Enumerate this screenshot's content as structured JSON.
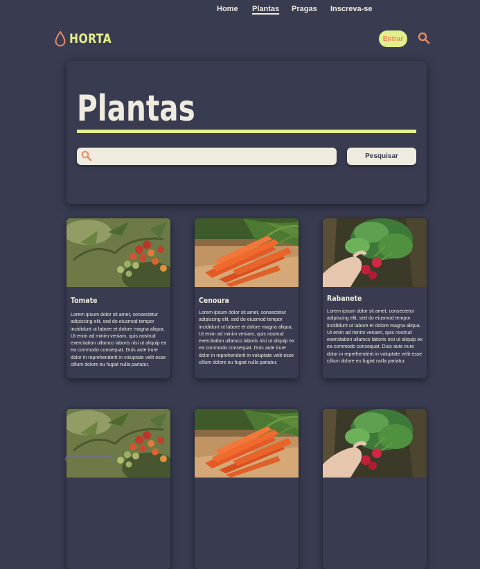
{
  "brand": {
    "name": "HORTA",
    "accent": "#e3f08a",
    "orange": "#e88a5e",
    "background": "#393c51",
    "cream": "#f0ebdf"
  },
  "nav": {
    "links": [
      "Home",
      "Plantas",
      "Pragas",
      "Inscreva-se"
    ],
    "active": "Plantas",
    "login_label": "Entrar"
  },
  "hero": {
    "title": "Plantas",
    "search_placeholder": "",
    "search_button": "Pesquisar"
  },
  "cards": [
    {
      "title": "Tomate",
      "image": "tomato-plant",
      "description": "Lorem ipsum dolor sit amet, consectetur adipiscing elit, sed do eiusmod tempor incididunt ut labore et dolore magna aliqua. Ut enim ad minim veniam, quis nostrud exercitation ullamco laboris nisi ut aliquip ex ea commodo consequat. Duis aute irure dolor in reprehenderit in voluptate velit esse cillum dolore eu fugiat nulla pariatur."
    },
    {
      "title": "Cenoura",
      "image": "carrots",
      "description": "Lorem ipsum dolor sit amet, consectetur adipiscing elit, sed do eiusmod tempor incididunt ut labore et dolore magna aliqua. Ut enim ad minim veniam, quis nostrud exercitation ullamco laboris nisi ut aliquip ex ea commodo consequat. Duis aute irure dolor in reprehenderit in voluptate velit esse cillum dolore eu fugiat nulla pariatur."
    },
    {
      "title": "Rabanete",
      "image": "radishes",
      "description": "Lorem ipsum dolor sit amet, consectetur adipiscing elit, sed do eiusmod tempor incididunt ut labore et dolore magna aliqua. Ut enim ad minim veniam, quis nostrud exercitation ullamco laboris nisi ut aliquip ex ea commodo consequat. Duis aute irure dolor in reprehenderit in voluptate velit esse cillum dolore eu fugiat nulla pariatur."
    }
  ],
  "icons": {
    "logo": "water-drop-icon",
    "search": "search-icon"
  }
}
